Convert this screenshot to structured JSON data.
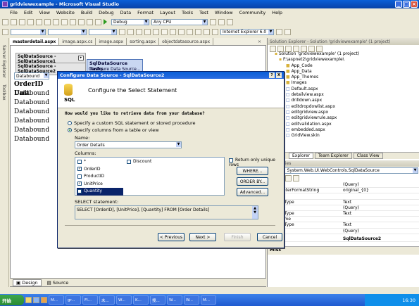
{
  "window": {
    "title": "gridviewexample - Microsoft Visual Studio"
  },
  "menu": [
    "File",
    "Edit",
    "View",
    "Website",
    "Build",
    "Debug",
    "Data",
    "Format",
    "Layout",
    "Tools",
    "Test",
    "Window",
    "Community",
    "Help"
  ],
  "toolbar1": {
    "config": "Debug",
    "platform": "Any CPU"
  },
  "toolbar2": {
    "browser": "Internet Explorer 6.0"
  },
  "side": {
    "server_explorer": "Server Explorer",
    "toolbox": "Toolbox"
  },
  "tabs": [
    "masterdetail.aspx",
    "image.aspx.cs",
    "image.aspx",
    "sorting.aspx",
    "objectdatasource.aspx"
  ],
  "designer": {
    "sds1": "SqlDataSource - SqlDataSource1",
    "sds2": "SqlDataSource - SqlDataSource2",
    "tasks": "SqlDataSource Tasks",
    "tasks_sub": "Configure Data Source...",
    "dropdown": "Databound",
    "grid_head": [
      "OrderID",
      "Unit"
    ],
    "grid_rows": [
      "Databound",
      "Databound",
      "Databound",
      "Databound",
      "Databound",
      "Databound"
    ]
  },
  "bottom_tabs": {
    "design": "Design",
    "source": "Source"
  },
  "dialog": {
    "title": "Configure Data Source - SqlDataSource2",
    "heading": "Configure the Select Statement",
    "icon_text": "SQL",
    "question": "How would you like to retrieve data from your database?",
    "opt_custom": "Specify a custom SQL statement or stored procedure",
    "opt_columns": "Specify columns from a table or view",
    "name_label": "Name:",
    "name_value": "Order Details",
    "columns_label": "Columns:",
    "columns_left": [
      {
        "label": "*",
        "checked": false
      },
      {
        "label": "OrderID",
        "checked": true
      },
      {
        "label": "ProductID",
        "checked": false
      },
      {
        "label": "UnitPrice",
        "checked": true
      },
      {
        "label": "Quantity",
        "checked": true
      }
    ],
    "columns_right": [
      {
        "label": "Discount",
        "checked": false
      }
    ],
    "unique_rows": "Return only unique rows",
    "where_btn": "WHERE...",
    "orderby_btn": "ORDER BY...",
    "advanced_btn": "Advanced...",
    "select_label": "SELECT statement:",
    "select_sql": "SELECT [OrderID], [UnitPrice], [Quantity] FROM [Order Details]",
    "prev_btn": "< Previous",
    "next_btn": "Next >",
    "finish_btn": "Finish",
    "cancel_btn": "Cancel",
    "help_btn": "?",
    "close_btn": "X"
  },
  "solution": {
    "title": "Solution Explorer - Solution 'gridviewexample' (1 project)",
    "items": [
      "Solution 'gridviewexample' (1 project)",
      "F:\\aspnet2\\gridviewexample\\",
      "App_Code",
      "App_Data",
      "App_Themes",
      "Images",
      "Default.aspx",
      "detailview.aspx",
      "drilldown.aspx",
      "editdropdowlist.aspx",
      "editgridview.aspx",
      "editgridviewrule.aspx",
      "editvalidation.aspx",
      "embedded.aspx",
      "GridView.skin"
    ],
    "tabs": [
      "Explorer",
      "Team Explorer",
      "Class View"
    ]
  },
  "properties": {
    "object": "ource2 System.Web.UI.WebControls.SqlDataSource",
    "rows": [
      [
        "ry",
        "(Query)"
      ],
      [
        "ParameterFormatString",
        "original_{0}"
      ],
      [
        "name",
        ""
      ],
      [
        "nmandType",
        "Text"
      ],
      [
        "ry",
        "(Query)"
      ],
      [
        "nmandType",
        "Text"
      ],
      [
        "eterName",
        ""
      ],
      [
        "nmandType",
        "Text"
      ],
      [
        "ery",
        "(Query)"
      ]
    ],
    "id_label": "(ID)",
    "id_value": "SqlDataSource2",
    "misc": "Misc"
  },
  "taskbar": {
    "start": "开始",
    "items": [
      "M...",
      "gr...",
      "Fl...",
      "未...",
      "W...",
      "K...",
      "搜...",
      "W...",
      "W...",
      "M..."
    ],
    "clock": "16:30"
  },
  "colors": {
    "title_blue": "#0a5fd8",
    "highlight": "#0a246a",
    "face": "#ece9d8"
  }
}
